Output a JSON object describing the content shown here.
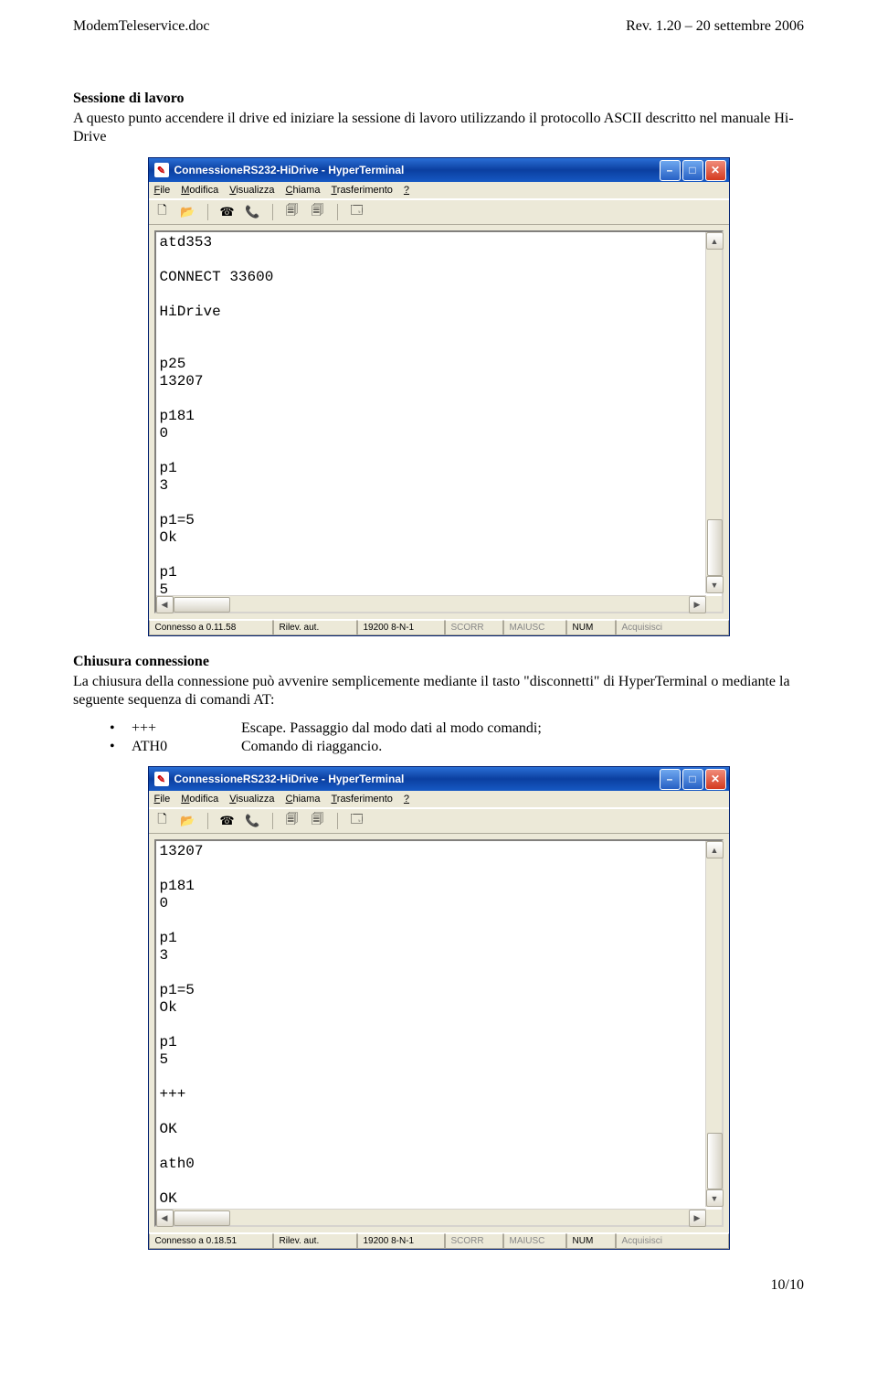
{
  "header": {
    "left": "ModemTeleservice.doc",
    "right": "Rev. 1.20 – 20 settembre 2006"
  },
  "section1": {
    "title": "Sessione di lavoro",
    "text": "A questo punto accendere il drive ed iniziare la sessione di lavoro utilizzando il protocollo ASCII descritto nel manuale Hi-Drive"
  },
  "window_title": "ConnessioneRS232-HiDrive - HyperTerminal",
  "menus": [
    "File",
    "Modifica",
    "Visualizza",
    "Chiama",
    "Trasferimento",
    "?"
  ],
  "menu_underline_idx": [
    0,
    0,
    0,
    0,
    0,
    0
  ],
  "terminal1_lines": "atd353\n\nCONNECT 33600\n\nHiDrive\n\n\np25\n13207\n\np181\n0\n\np1\n3\n\np1=5\nOk\n\np1\n5\n\n_",
  "status1": {
    "conn": "Connesso a 0.11.58",
    "rilev": "Rilev. aut.",
    "port": "19200 8-N-1",
    "scorr": "SCORR",
    "maiusc": "MAIUSC",
    "num": "NUM",
    "acq": "Acquisisci"
  },
  "section2": {
    "title": "Chiusura connessione",
    "text": "La chiusura della connessione può avvenire semplicemente mediante il tasto \"disconnetti\" di HyperTerminal o mediante la seguente sequenza di comandi AT:",
    "bullets": [
      {
        "cmd": "+++",
        "desc": "Escape. Passaggio dal modo dati al modo comandi;"
      },
      {
        "cmd": "ATH0",
        "desc": "Comando di riaggancio."
      }
    ]
  },
  "terminal2_lines": "13207\n\np181\n0\n\np1\n3\n\np1=5\nOk\n\np1\n5\n\n+++\n\nOK\n\nath0\n\nOK\n\n_",
  "status2": {
    "conn": "Connesso a 0.18.51",
    "rilev": "Rilev. aut.",
    "port": "19200 8-N-1",
    "scorr": "SCORR",
    "maiusc": "MAIUSC",
    "num": "NUM",
    "acq": "Acquisisci"
  },
  "footer": "10/10"
}
